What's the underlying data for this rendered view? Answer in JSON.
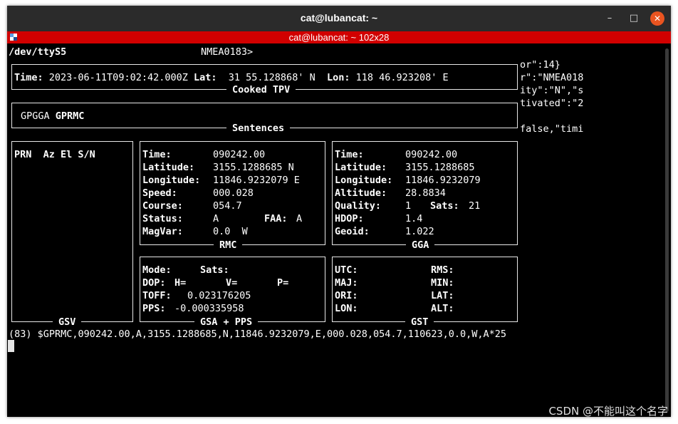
{
  "window": {
    "title": "cat@lubancat: ~",
    "minimize_glyph": "–",
    "maximize_glyph": "□",
    "close_glyph": "✕"
  },
  "inner_title": "cat@lubancat: ~ 102x28",
  "header": {
    "device": "/dev/ttyS5",
    "protocol": "NMEA0183>"
  },
  "overflow_lines": [
    "or\":14}",
    "r\":\"NMEA018",
    "ity\":\"N\",\"s",
    "tivated\":\"2",
    "false,\"timi"
  ],
  "tpv": {
    "label": "Cooked TPV",
    "time_key": "Time:",
    "time_val": "2023-06-11T09:02:42.000Z",
    "lat_key": "Lat:",
    "lat_val": " 31 55.128868' N",
    "lon_key": "Lon:",
    "lon_val": "118 46.923208' E"
  },
  "sentences": {
    "label": "Sentences",
    "plain": "GPGGA ",
    "bold": "GPRMC"
  },
  "gsv": {
    "label": "GSV",
    "header": "PRN  Az El S/N"
  },
  "rmc": {
    "label": "RMC",
    "rows": [
      {
        "k": "Time:",
        "v": "090242.00"
      },
      {
        "k": "Latitude:",
        "v": "3155.1288685 N"
      },
      {
        "k": "Longitude:",
        "v": "11846.9232079 E"
      },
      {
        "k": "Speed:",
        "v": "000.028"
      },
      {
        "k": "Course:",
        "v": "054.7"
      },
      {
        "k": "Status:",
        "v": "A",
        "k2": "FAA:",
        "v2": "A"
      },
      {
        "k": "MagVar:",
        "v": "0.0  W"
      }
    ]
  },
  "gga": {
    "label": "GGA",
    "rows": [
      {
        "k": "Time:",
        "v": "090242.00"
      },
      {
        "k": "Latitude:",
        "v": "3155.1288685"
      },
      {
        "k": "Longitude:",
        "v": "11846.9232079"
      },
      {
        "k": "Altitude:",
        "v": "28.8834"
      },
      {
        "k": "Quality:",
        "v": "1",
        "k2": "Sats:",
        "v2": "21"
      },
      {
        "k": "HDOP:",
        "v": "1.4"
      },
      {
        "k": "Geoid:",
        "v": "1.022"
      }
    ]
  },
  "gsa": {
    "label": "GSA + PPS",
    "mode": "Mode:",
    "sats": "Sats:",
    "dop": "DOP:",
    "h": "H=",
    "v": "V=",
    "p": "P=",
    "toff_key": "TOFF:",
    "toff_val": "0.023176205",
    "pps_key": "PPS:",
    "pps_val": "-0.000335958"
  },
  "gst": {
    "label": "GST",
    "utc": "UTC:",
    "rms": "RMS:",
    "maj": "MAJ:",
    "min": "MIN:",
    "ori": "ORI:",
    "lat": "LAT:",
    "lon": "LON:",
    "alt": "ALT:"
  },
  "raw_line": "(83) $GPRMC,090242.00,A,3155.1288685,N,11846.9232079,E,000.028,054.7,110623,0.0,W,A*25",
  "watermark": "CSDN @不能叫这个名字"
}
